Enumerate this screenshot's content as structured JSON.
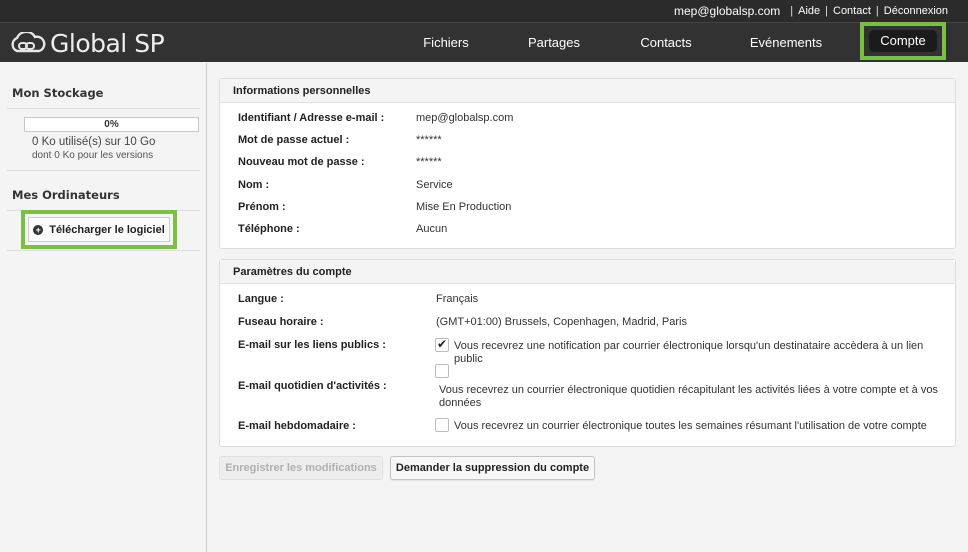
{
  "topbar": {
    "email": "mep@globalsp.com",
    "links": [
      "Aide",
      "Contact",
      "Déconnexion"
    ]
  },
  "logo": {
    "text": "Global SP",
    "icon": "cloud-logo-icon"
  },
  "nav": {
    "items": [
      "Fichiers",
      "Partages",
      "Contacts",
      "Evénements",
      "Compte"
    ],
    "active": "Compte"
  },
  "sidebar": {
    "storage_title": "Mon Stockage",
    "progress": "0%",
    "progress_fraction": 0,
    "usage": "0 Ko utilisé(s) sur 10 Go",
    "usage_versions": "dont 0 Ko pour les versions",
    "computers_title": "Mes Ordinateurs",
    "download_label": "Télécharger le logiciel"
  },
  "personal": {
    "title": "Informations personnelles",
    "rows": [
      {
        "label": "Identifiant / Adresse e-mail :",
        "value": "mep@globalsp.com"
      },
      {
        "label": "Mot de passe actuel :",
        "value": "******"
      },
      {
        "label": "Nouveau mot de passe :",
        "value": "******"
      },
      {
        "label": "Nom :",
        "value": "Service"
      },
      {
        "label": "Prénom :",
        "value": "Mise En Production"
      },
      {
        "label": "Téléphone :",
        "value": "Aucun"
      }
    ]
  },
  "account": {
    "title": "Paramètres du compte",
    "language_label": "Langue :",
    "language_value": "Français",
    "timezone_label": "Fuseau horaire :",
    "timezone_value": "(GMT+01:00) Brussels, Copenhagen, Madrid, Paris",
    "public_links_label": "E-mail sur les liens publics :",
    "public_links_checked": true,
    "public_links_text": "Vous recevrez une notification par courrier électronique lorsqu'un destinataire accèdera à un lien public",
    "daily_label": "E-mail quotidien d'activités :",
    "daily_checked": false,
    "daily_text_1": "Vous recevrez un courrier électronique quotidien récapitulant les activités liées à votre compte et à vos",
    "daily_text_2": "données",
    "weekly_label": "E-mail hebdomadaire :",
    "weekly_checked": false,
    "weekly_text": "Vous recevrez un courrier électronique toutes les semaines résumant l'utilisation de votre compte"
  },
  "buttons": {
    "save": "Enregistrer les modifications",
    "delete": "Demander la suppression du compte"
  },
  "colors": {
    "highlight": "#7ac143",
    "header_bg": "#323232",
    "topbar_bg": "#2b2b2b"
  }
}
